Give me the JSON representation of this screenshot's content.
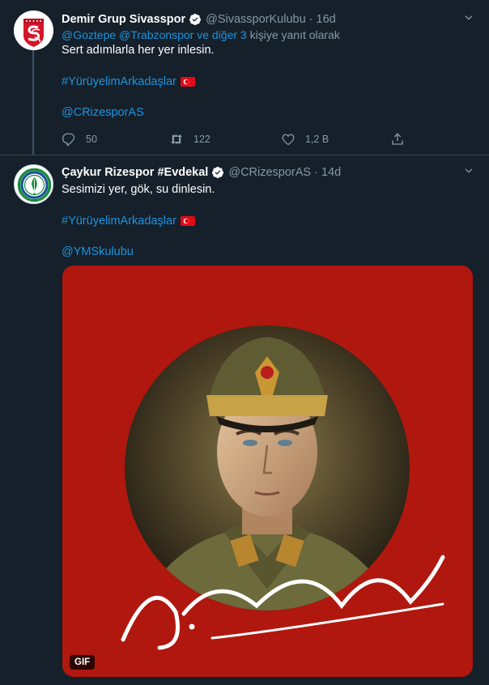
{
  "tweets": [
    {
      "author_name": "Demir Grup Sivasspor",
      "handle": "@SivassporKulubu",
      "separator": "·",
      "time": "16d",
      "reply_to": {
        "user1": "@Goztepe",
        "user2": "@Trabzonspor",
        "others": "ve diğer 3",
        "suffix": "kişiye yanıt olarak"
      },
      "body": "Sert adımlarla her yer inlesin.",
      "hashtag": "#YürüyelimArkadaşlar",
      "mention": "@CRizesporAS",
      "actions": {
        "replies": "50",
        "retweets": "122",
        "likes": "1,2 B"
      }
    },
    {
      "author_name": "Çaykur Rizespor #Evdekal",
      "handle": "@CRizesporAS",
      "separator": "·",
      "time": "14d",
      "body": "Sesimizi yer, gök, su dinlesin.",
      "hashtag": "#YürüyelimArkadaşlar",
      "mention": "@YMSkulubu",
      "media": {
        "badge": "GIF"
      }
    }
  ],
  "colors": {
    "background": "#15202b",
    "link": "#1b95e0",
    "muted": "#8899a6",
    "media_background": "#b0170e"
  },
  "icons": [
    "verified-badge-icon",
    "chevron-down-icon",
    "reply-icon",
    "retweet-icon",
    "like-icon",
    "share-icon",
    "turkish-flag-icon"
  ]
}
